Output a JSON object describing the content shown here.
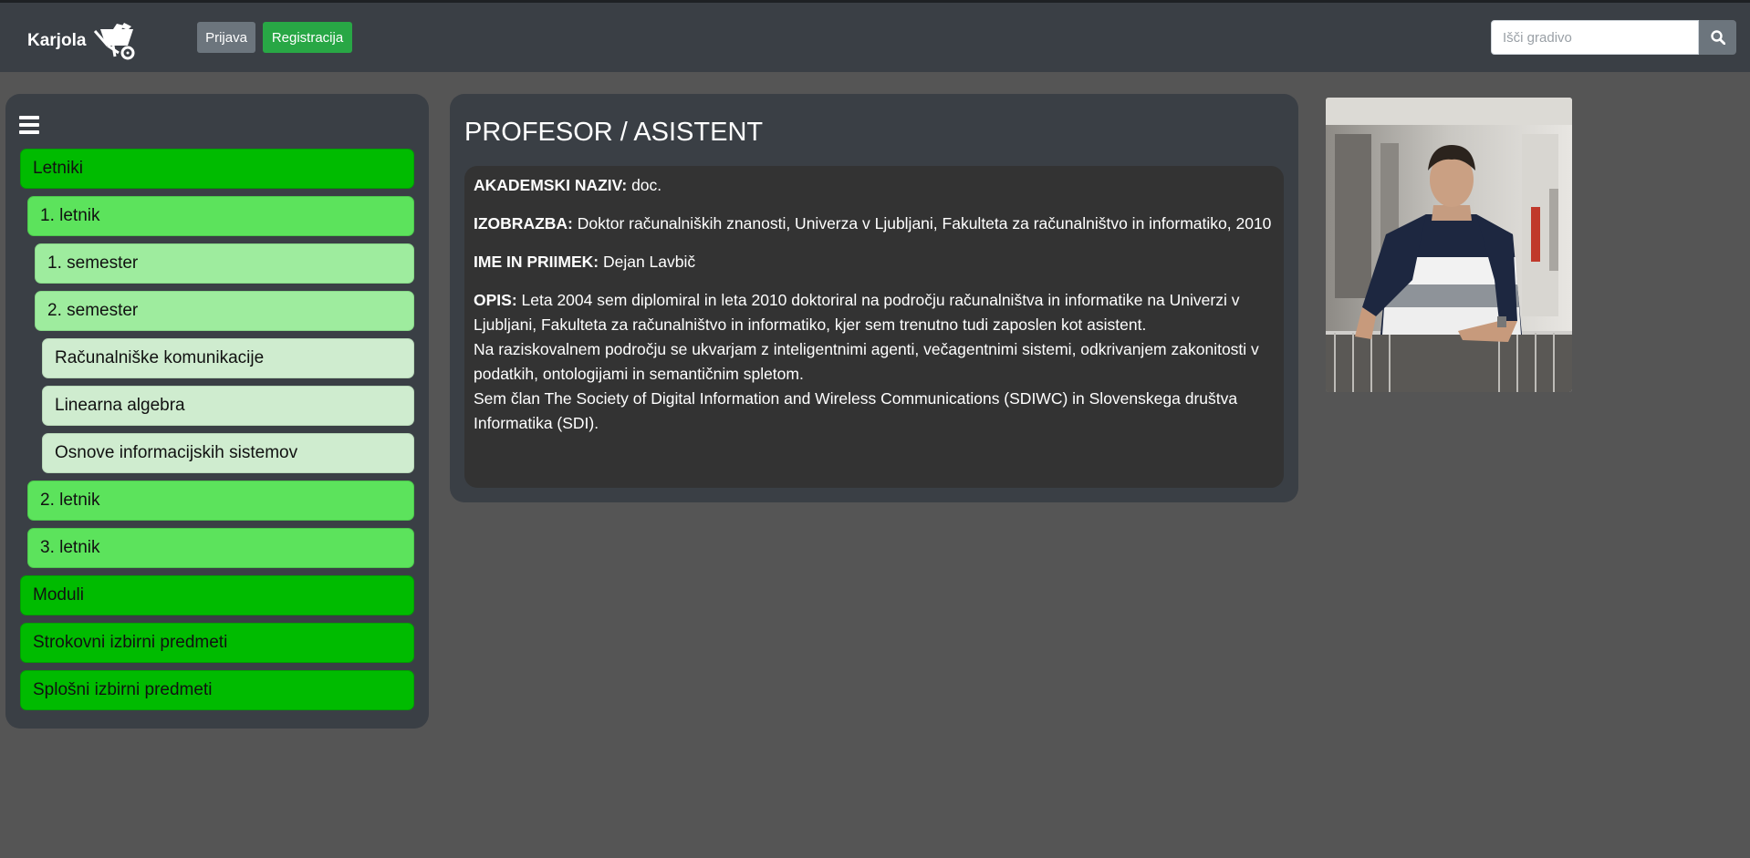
{
  "navbar": {
    "brand": "Karjola",
    "login_label": "Prijava",
    "register_label": "Registracija",
    "search_placeholder": "Išči gradivo",
    "search_icon": "search-icon"
  },
  "sidebar": {
    "menu_icon": "hamburger-icon",
    "items": [
      {
        "label": "Letniki",
        "level": 0
      },
      {
        "label": "1. letnik",
        "level": 1
      },
      {
        "label": "1. semester",
        "level": 2
      },
      {
        "label": "2. semester",
        "level": 2
      },
      {
        "label": "Računalniške komunikacije",
        "level": 3
      },
      {
        "label": "Linearna algebra",
        "level": 3
      },
      {
        "label": "Osnove informacijskih sistemov",
        "level": 3
      },
      {
        "label": "2. letnik",
        "level": 1
      },
      {
        "label": "3. letnik",
        "level": 1
      },
      {
        "label": "Moduli",
        "level": 0
      },
      {
        "label": "Strokovni izbirni predmeti",
        "level": 0
      },
      {
        "label": "Splošni izbirni predmeti",
        "level": 0
      }
    ]
  },
  "profile": {
    "title": "PROFESOR / ASISTENT",
    "academic_title_label": "AKADEMSKI NAZIV:",
    "academic_title_value": "doc.",
    "education_label": "IZOBRAZBA:",
    "education_value": "Doktor računalniških znanosti, Univerza v Ljubljani, Fakulteta za računalništvo in informatiko, 2010",
    "name_label": "IME IN PRIIMEK:",
    "name_value": "Dejan Lavbič",
    "description_label": "OPIS:",
    "description_lines": [
      "Leta 2004 sem diplomiral in leta 2010 doktoriral na področju računalništva in informatike na Univerzi v Ljubljani, Fakulteta za računalništvo in informatiko, kjer sem trenutno tudi zaposlen kot asistent.",
      "Na raziskovalnem področju se ukvarjam z inteligentnimi agenti, večagentnimi sistemi, odkrivanjem zakonitosti v podatkih, ontologijami in semantičnim spletom.",
      "Sem član The Society of Digital Information and Wireless Communications (SDIWC) in Slovenskega društva Informatika (SDI)."
    ]
  },
  "colors": {
    "page_bg": "#555555",
    "panel_bg": "#3a3f45",
    "level0": "#00bb00",
    "level1": "#5ce35c",
    "level2": "#9eec9e",
    "level3": "#cfeccf",
    "register_btn": "#28a745",
    "login_btn": "#6c757d"
  }
}
